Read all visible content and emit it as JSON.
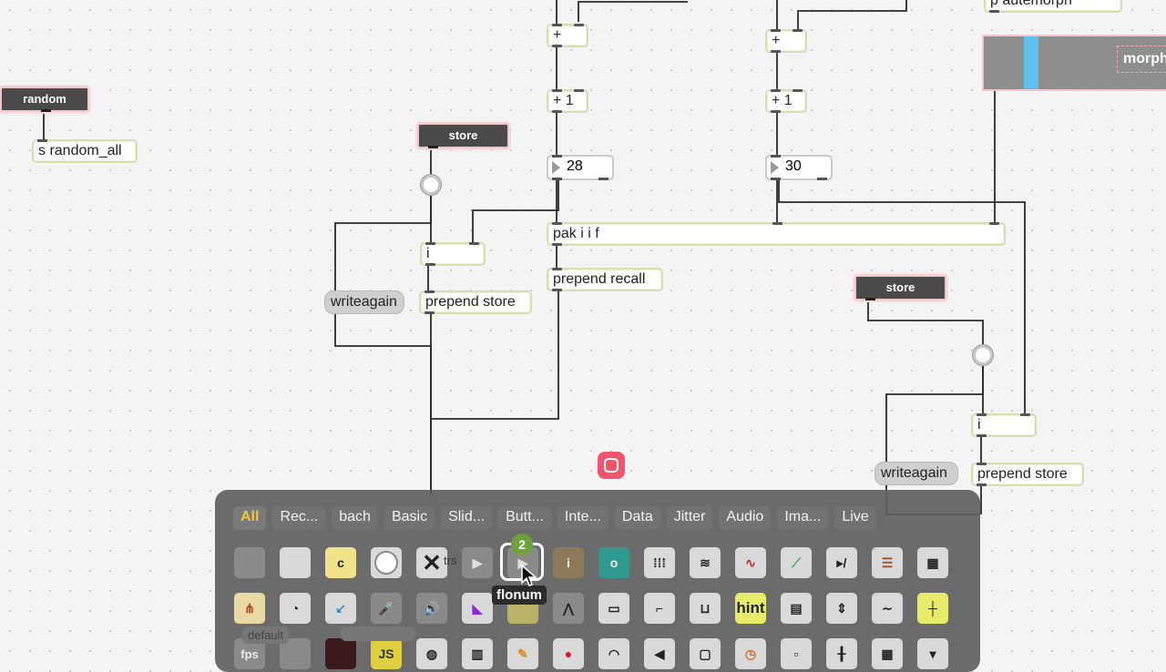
{
  "canvas": {
    "random_button": "random",
    "send_random": "s random_all",
    "store_left": "store",
    "store_right": "store",
    "int_left": "i",
    "int_right": "i",
    "writeagain_left": "writeagain",
    "writeagain_right": "writeagain",
    "prepend_store_left": "prepend store",
    "prepend_store_right": "prepend store",
    "plus_a": "+",
    "plus_b": "+",
    "plus1_a": "+ 1",
    "plus1_b": "+ 1",
    "number_a": "28",
    "number_b": "30",
    "pak": "pak i i f",
    "prepend_recall": "prepend recall",
    "top_right_obj": "p autemorph",
    "morph_label": "morph"
  },
  "palette": {
    "categories": [
      "All",
      "Rec...",
      "bach",
      "Basic",
      "Slid...",
      "Butt...",
      "Inte...",
      "Data",
      "Jitter",
      "Audio",
      "Ima...",
      "Live"
    ],
    "active_category": "All",
    "hover_badge": "2",
    "tooltip": "flonum",
    "tile_hint": "hint",
    "tile_fps": "fps",
    "tile_js": "JS",
    "tile_c": "c",
    "tile_i": "i",
    "tile_o": "o",
    "ghost_default": "default",
    "ghost_trs": "trs"
  },
  "colors": {
    "accent_active_category": "#f4c542",
    "record_button": "#f0556b",
    "morph_handle": "#5fc0f0",
    "badge": "#6fa13d"
  }
}
